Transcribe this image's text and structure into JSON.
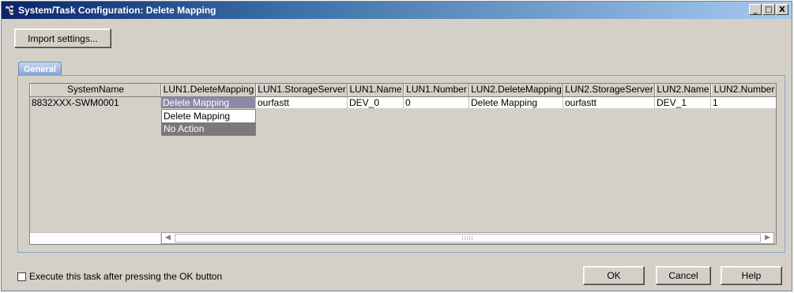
{
  "window": {
    "title": "System/Task Configuration: Delete Mapping",
    "controls": [
      "_",
      "□",
      "X"
    ]
  },
  "toolbar": {
    "import_label": "Import settings..."
  },
  "tabs": [
    {
      "label": "General",
      "active": true
    }
  ],
  "table": {
    "columns": [
      "SystemName",
      "LUN1.DeleteMapping",
      "LUN1.StorageServer",
      "LUN1.Name",
      "LUN1.Number",
      "LUN2.DeleteMapping",
      "LUN2.StorageServer",
      "LUN2.Name",
      "LUN2.Number"
    ],
    "rows": [
      {
        "cells": [
          "8832XXX-SWM0001",
          "Delete Mapping",
          "ourfastt",
          "DEV_0",
          "0",
          "Delete Mapping",
          "ourfastt",
          "DEV_1",
          "1"
        ]
      }
    ]
  },
  "dropdown": {
    "options": [
      "Delete Mapping",
      "No Action"
    ],
    "highlighted": "No Action"
  },
  "footer": {
    "checkbox_label": "Execute this task after pressing the OK button",
    "checkbox_checked": false,
    "ok_label": "OK",
    "cancel_label": "Cancel",
    "help_label": "Help"
  },
  "colors": {
    "title_gradient_start": "#0a246a",
    "title_gradient_end": "#a6caf0",
    "window_bg": "#d4d0c8",
    "selected_cell": "#8a8aa8",
    "highlight_option": "#7a7a7a",
    "tab_blue": "#7b9fcf"
  },
  "icons": {
    "title_icon": "system-task-icon",
    "scroll_left": "scroll-left-arrow-icon",
    "scroll_right": "scroll-right-arrow-icon"
  }
}
